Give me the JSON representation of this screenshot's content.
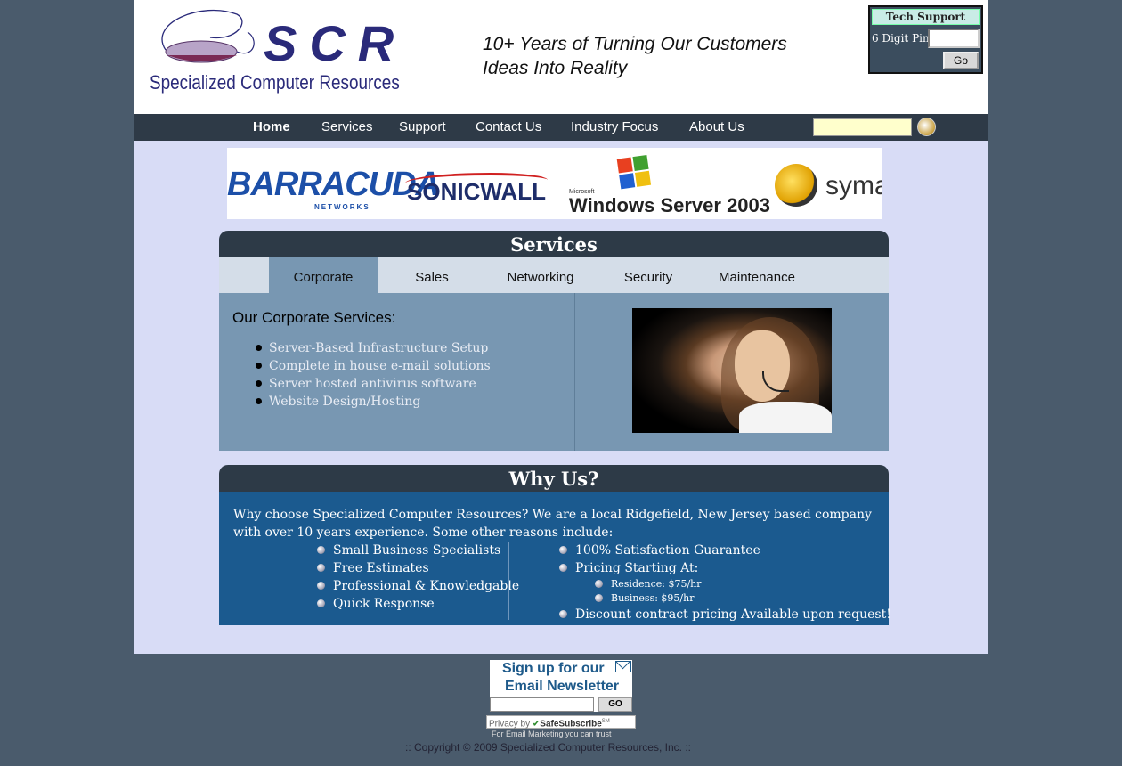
{
  "header": {
    "logo_letters": "SCR",
    "logo_subtitle": "Specialized Computer Resources",
    "tagline_line1": "10+ Years of Turning Our Customers",
    "tagline_line2": "Ideas Into Reality"
  },
  "tech_support": {
    "title": "Tech Support",
    "pin_label": "6 Digit Pin:",
    "pin_value": "",
    "go_label": "Go"
  },
  "nav": {
    "items": [
      "Home",
      "Services",
      "Support",
      "Contact Us",
      "Industry Focus",
      "About Us"
    ],
    "active": "Home",
    "search_value": ""
  },
  "banner": {
    "brands": [
      "BARRACUDA",
      "NETWORKS",
      "SONICWALL",
      "Microsoft",
      "Windows Server 2003",
      "syma"
    ]
  },
  "services": {
    "heading": "Services",
    "tabs": [
      "Corporate",
      "Sales",
      "Networking",
      "Security",
      "Maintenance"
    ],
    "active_tab": "Corporate",
    "title": "Our Corporate Services:",
    "items": [
      "Server-Based Infrastructure Setup",
      "Complete in house e-mail solutions",
      "Server hosted antivirus software",
      "Website Design/Hosting"
    ]
  },
  "why_us": {
    "heading": "Why Us?",
    "intro": "Why choose Specialized Computer Resources? We are a local Ridgefield, New Jersey based company with over 10 years experience. Some other reasons include:",
    "left_items": [
      "Small Business Specialists",
      "Free Estimates",
      "Professional & Knowledgable",
      "Quick Response"
    ],
    "right_items": [
      "100% Satisfaction Guarantee",
      "Pricing Starting At:"
    ],
    "pricing": [
      "Residence: $75/hr",
      "Business: $95/hr"
    ],
    "last_item": "Discount contract pricing Available upon request!"
  },
  "newsletter": {
    "line1": "Sign up for our",
    "line2": "Email Newsletter",
    "input_value": "",
    "go_label": "GO",
    "privacy_prefix": "Privacy by",
    "privacy_brand": "SafeSubscribe",
    "privacy_mark": "SM",
    "tagline": "For Email Marketing you can trust"
  },
  "footer": {
    "copyright": ":: Copyright © 2009 Specialized Computer Resources, Inc. ::"
  }
}
